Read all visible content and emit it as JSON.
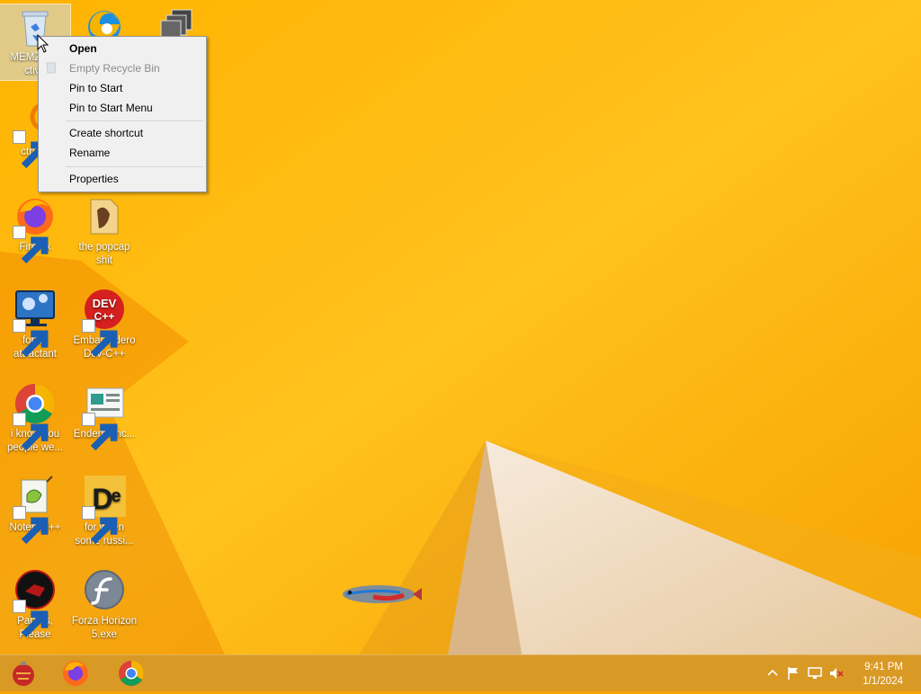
{
  "desktop": {
    "icons": [
      {
        "label": "MEMZ-Cle ctive",
        "name": "memz-recycle-bin-icon"
      },
      {
        "label": "",
        "name": "edge-icon"
      },
      {
        "label": "...n",
        "name": "stacked-windows-icon"
      },
      {
        "label": "ctrl+a,",
        "name": "ctrl-a-icon"
      },
      {
        "label": "Firefox",
        "name": "firefox-icon"
      },
      {
        "label": "the popcap shit",
        "name": "popcap-folder-icon"
      },
      {
        "label": "forkie attractant",
        "name": "forkie-attractant-icon"
      },
      {
        "label": "Embarcadero Dev-C++",
        "name": "embarcadero-devcpp-icon"
      },
      {
        "label": "i know you people we...",
        "name": "chrome-shortcut-icon"
      },
      {
        "label": "Endermanc...",
        "name": "endermanch-icon"
      },
      {
        "label": "Notepad++",
        "name": "notepadpp-icon"
      },
      {
        "label": "for when some russi...",
        "name": "de-app-icon"
      },
      {
        "label": "Papers, Please",
        "name": "papers-please-icon"
      },
      {
        "label": "Forza Horizon 5.exe",
        "name": "flash-forza-icon"
      }
    ]
  },
  "context_menu": {
    "open": "Open",
    "empty_recycle_bin": "Empty Recycle Bin",
    "pin_to_start": "Pin to Start",
    "pin_to_start_menu": "Pin to Start Menu",
    "create_shortcut": "Create shortcut",
    "rename": "Rename",
    "properties": "Properties"
  },
  "taskbar": {
    "apps": [
      "ornament-app-icon",
      "firefox-taskbar-icon",
      "chrome-taskbar-icon"
    ],
    "tray": [
      "show-hidden-icons-chevron",
      "action-center-flag-icon",
      "network-icon",
      "volume-muted-icon"
    ],
    "time": "9:41 PM",
    "date": "1/1/2024"
  },
  "colors": {
    "wallpaper_main": "#f6a400",
    "wallpaper_light": "#ffc229",
    "paper_white": "#f3e3cb",
    "taskbar": "#d69828"
  }
}
